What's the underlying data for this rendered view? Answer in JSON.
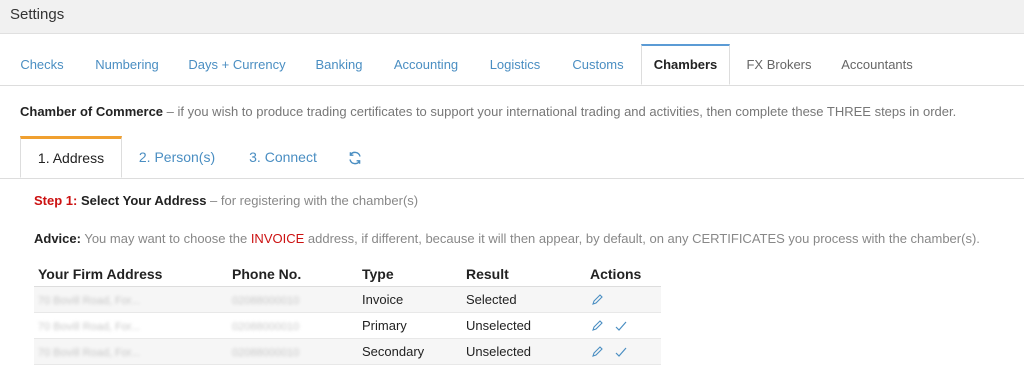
{
  "header": {
    "title": "Settings"
  },
  "tabs": [
    {
      "label": "Checks"
    },
    {
      "label": "Numbering"
    },
    {
      "label": "Days + Currency"
    },
    {
      "label": "Banking"
    },
    {
      "label": "Accounting"
    },
    {
      "label": "Logistics"
    },
    {
      "label": "Customs"
    },
    {
      "label": "Chambers"
    },
    {
      "label": "FX Brokers"
    },
    {
      "label": "Accountants"
    }
  ],
  "intro": {
    "bold": "Chamber of Commerce",
    "text": " – if you wish to produce trading certificates to support your international trading and activities, then complete these THREE steps in order."
  },
  "subtabs": [
    {
      "label": "1. Address"
    },
    {
      "label": "2. Person(s)"
    },
    {
      "label": "3. Connect"
    }
  ],
  "step": {
    "prefix": "Step 1:",
    "bold": " Select Your Address",
    "text": " – for registering with the chamber(s)"
  },
  "advice": {
    "bold": "Advice:",
    "text1": " You may want to choose the ",
    "highlight": "INVOICE",
    "text2": " address, if different, because it will then appear, by default, on any CERTIFICATES you process with the chamber(s)."
  },
  "table": {
    "headers": [
      "Your Firm Address",
      "Phone No.",
      "Type",
      "Result",
      "Actions"
    ],
    "rows": [
      {
        "address": "70 Bovill Road, For...",
        "phone": "02088000010",
        "type": "Invoice",
        "result": "Selected"
      },
      {
        "address": "70 Bovill Road, For...",
        "phone": "02088000010",
        "type": "Primary",
        "result": "Unselected"
      },
      {
        "address": "70 Bovill Road, For...",
        "phone": "02088000010",
        "type": "Secondary",
        "result": "Unselected"
      }
    ]
  },
  "colors": {
    "link": "#4a8ec2",
    "active_tab_border": "#5b9bd5",
    "subtab_accent": "#f0a030",
    "selected": "#e05050",
    "unselected": "#5bb78d"
  }
}
